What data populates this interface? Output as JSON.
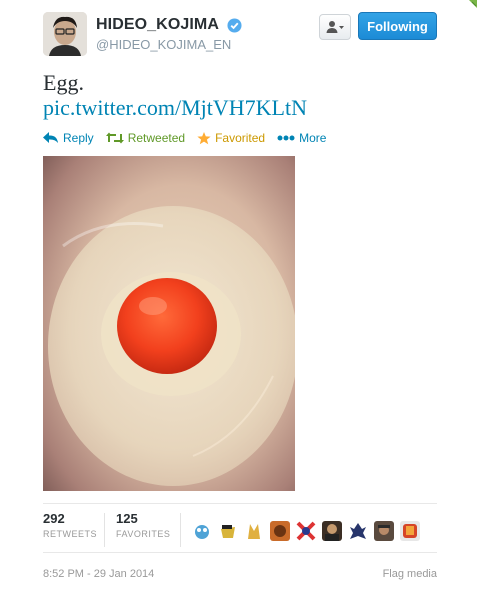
{
  "header": {
    "display_name": "HIDEO_KOJIMA",
    "username": "@HIDEO_KOJIMA_EN",
    "follow_label": "Following"
  },
  "tweet": {
    "text": "Egg.",
    "link": "pic.twitter.com/MjtVH7KLtN"
  },
  "actions": {
    "reply": "Reply",
    "retweeted": "Retweeted",
    "favorited": "Favorited",
    "more": "More"
  },
  "stats": {
    "retweets_count": "292",
    "retweets_label": "RETWEETS",
    "favorites_count": "125",
    "favorites_label": "FAVORITES"
  },
  "footer": {
    "timestamp": "8:52 PM - 29 Jan 2014",
    "flag_media": "Flag media"
  },
  "colors": {
    "link": "#0084b4",
    "retweet_green": "#609928",
    "favorite_gold": "#ffac33",
    "follow_button": "#2b9ce4"
  },
  "icons": [
    "verified-badge-icon",
    "user-dropdown-icon",
    "reply-icon",
    "retweet-icon",
    "star-icon",
    "more-dots-icon"
  ]
}
